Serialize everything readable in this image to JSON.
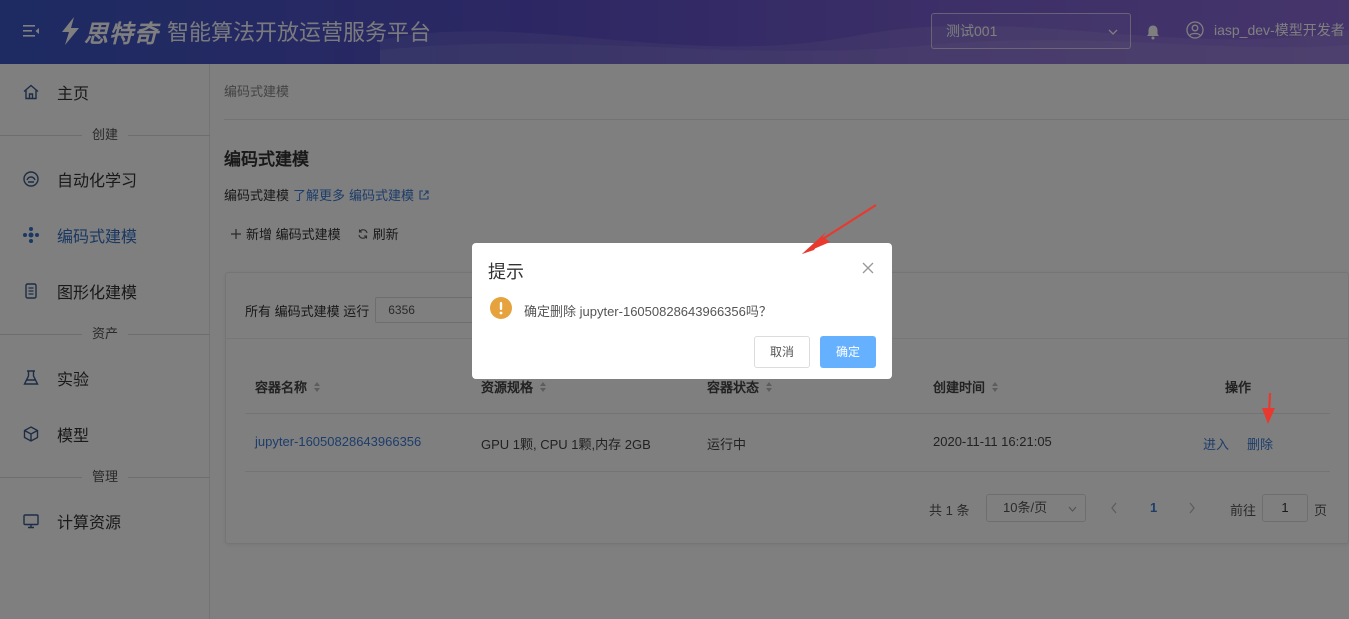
{
  "header": {
    "brand": "思特奇",
    "platform": "智能算法开放运营服务平台",
    "project": "测试001",
    "user": "iasp_dev-模型开发者"
  },
  "sidebar": {
    "items": [
      {
        "label": "主页",
        "icon": "home-icon"
      },
      {
        "label": "自动化学习",
        "icon": "automl-icon"
      },
      {
        "label": "编码式建模",
        "icon": "code-model-icon"
      },
      {
        "label": "图形化建模",
        "icon": "graph-model-icon"
      },
      {
        "label": "实验",
        "icon": "flask-icon"
      },
      {
        "label": "模型",
        "icon": "cube-icon"
      },
      {
        "label": "计算资源",
        "icon": "monitor-icon"
      }
    ],
    "sections": {
      "create": "创建",
      "assets": "资产",
      "manage": "管理"
    }
  },
  "main": {
    "breadcrumb": "编码式建模",
    "title": "编码式建模",
    "desc_text": "编码式建模",
    "desc_link1": "了解更多",
    "desc_link2": "编码式建模",
    "toolbar": {
      "add": "新增 编码式建模",
      "refresh": "刷新"
    },
    "filter": {
      "label": "所有 编码式建模 运行",
      "value": "6356"
    },
    "table": {
      "headers": [
        "容器名称",
        "资源规格",
        "容器状态",
        "创建时间",
        "操作"
      ],
      "rows": [
        {
          "name": "jupyter-16050828643966356",
          "spec": "GPU 1颗, CPU 1颗,内存 2GB",
          "status": "运行中",
          "created": "2020-11-11 16:21:05",
          "enter": "进入",
          "delete": "删除"
        }
      ]
    },
    "pagination": {
      "total": "共 1 条",
      "page_size": "10条/页",
      "current": "1",
      "goto_label": "前往",
      "goto_value": "1",
      "page_suffix": "页"
    }
  },
  "dialog": {
    "title": "提示",
    "message": "确定删除 jupyter-16050828643966356吗？",
    "cancel": "取消",
    "confirm": "确定"
  },
  "colors": {
    "accent": "#3a7bd5",
    "confirm": "#66b1ff",
    "warning": "#e6a23c",
    "annotation": "#e8392f"
  }
}
